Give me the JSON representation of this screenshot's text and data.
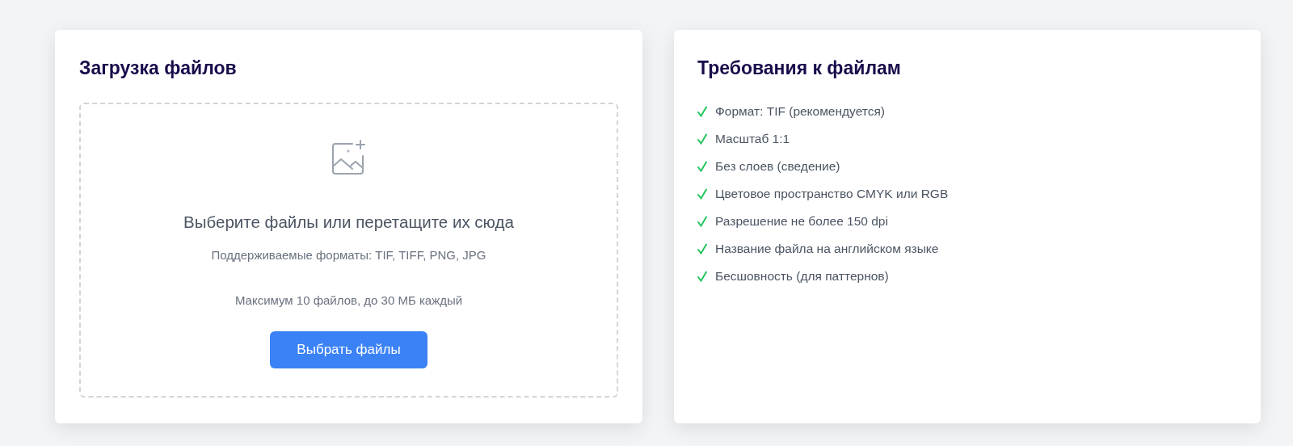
{
  "upload": {
    "title": "Загрузка файлов",
    "dropzone": {
      "prompt": "Выберите файлы или перетащите их сюда",
      "formats": "Поддерживаемые форматы: TIF, TIFF, PNG, JPG",
      "limits": "Максимум 10 файлов, до 30 МБ каждый",
      "button": "Выбрать файлы"
    }
  },
  "requirements": {
    "title": "Требования к файлам",
    "items": [
      {
        "text": "Формат: TIF (рекомендуется)"
      },
      {
        "text": "Масштаб 1:1"
      },
      {
        "text": "Без слоев (сведение)"
      },
      {
        "text": "Цветовое пространство CMYK или RGB"
      },
      {
        "text": "Разрешение не более 150 dpi"
      },
      {
        "text": "Название файла на английском языке"
      },
      {
        "text": "Бесшовность (для паттернов)"
      }
    ]
  }
}
